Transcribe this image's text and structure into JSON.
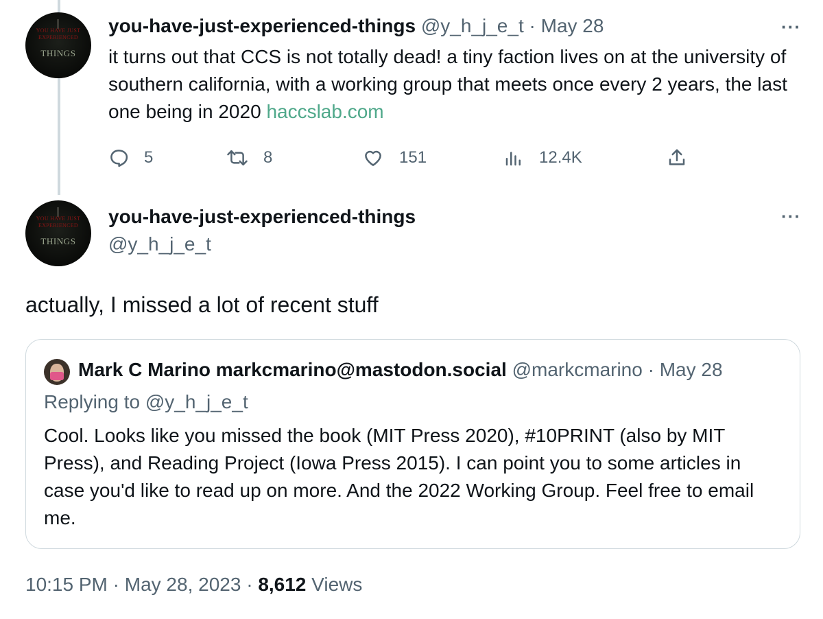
{
  "tweet1": {
    "author_name": "you-have-just-experienced-things",
    "handle": "@y_h_j_e_t",
    "separator": "·",
    "date": "May 28",
    "text": "it turns out that CCS is not totally dead! a tiny faction lives on at the university of southern california, with a working group that meets once every 2 years, the last one being in 2020 ",
    "link": "haccslab.com",
    "more_icon": "more-icon",
    "stats": {
      "replies": "5",
      "retweets": "8",
      "likes": "151",
      "views": "12.4K"
    }
  },
  "tweet2": {
    "author_name": "you-have-just-experienced-things",
    "handle": "@y_h_j_e_t",
    "text": "actually, I missed a lot of recent stuff",
    "more_icon": "more-icon"
  },
  "avatar_text": {
    "top_line": "YOU HAVE JUST",
    "second_line": "EXPERIENCED",
    "word": "THINGS"
  },
  "quote": {
    "author_name": "Mark C Marino markcmarino@mastodon.social",
    "handle": "@markcmarino",
    "separator": "·",
    "date": "May 28",
    "replying_to": "Replying to @y_h_j_e_t",
    "text": "Cool. Looks like you missed the book (MIT Press 2020),  #10PRINT (also by MIT Press), and Reading Project (Iowa Press 2015).  I can point you to some articles in case you'd like to read up on more. And the 2022 Working Group. Feel free to email me."
  },
  "meta": {
    "time": "10:15 PM",
    "separator": "·",
    "date": "May 28, 2023",
    "views_count": "8,612",
    "views_label": "Views"
  },
  "colors": {
    "text": "#0f1419",
    "muted": "#536471",
    "link": "#4fa88a",
    "border": "#cfd9de"
  }
}
